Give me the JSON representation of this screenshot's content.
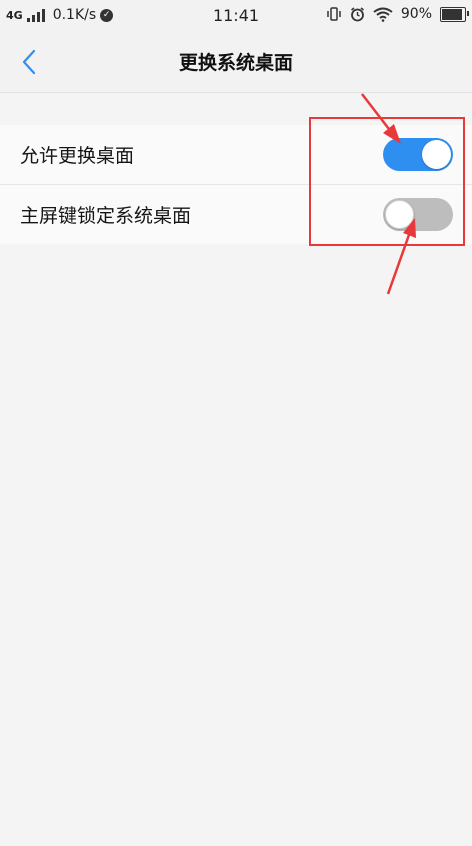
{
  "status_bar": {
    "network": "4G",
    "speed": "0.1K/s",
    "time": "11:41",
    "battery": "90%",
    "battery_level": 0.9
  },
  "header": {
    "title": "更换系统桌面",
    "back_icon": "chevron-left-icon"
  },
  "settings": [
    {
      "label": "允许更换桌面",
      "enabled": true
    },
    {
      "label": "主屏键锁定系统桌面",
      "enabled": false
    }
  ],
  "colors": {
    "accent": "#2e8ff0",
    "toggle_off": "#bdbdbd",
    "annotation": "#e8383a",
    "background": "#f4f4f5"
  }
}
